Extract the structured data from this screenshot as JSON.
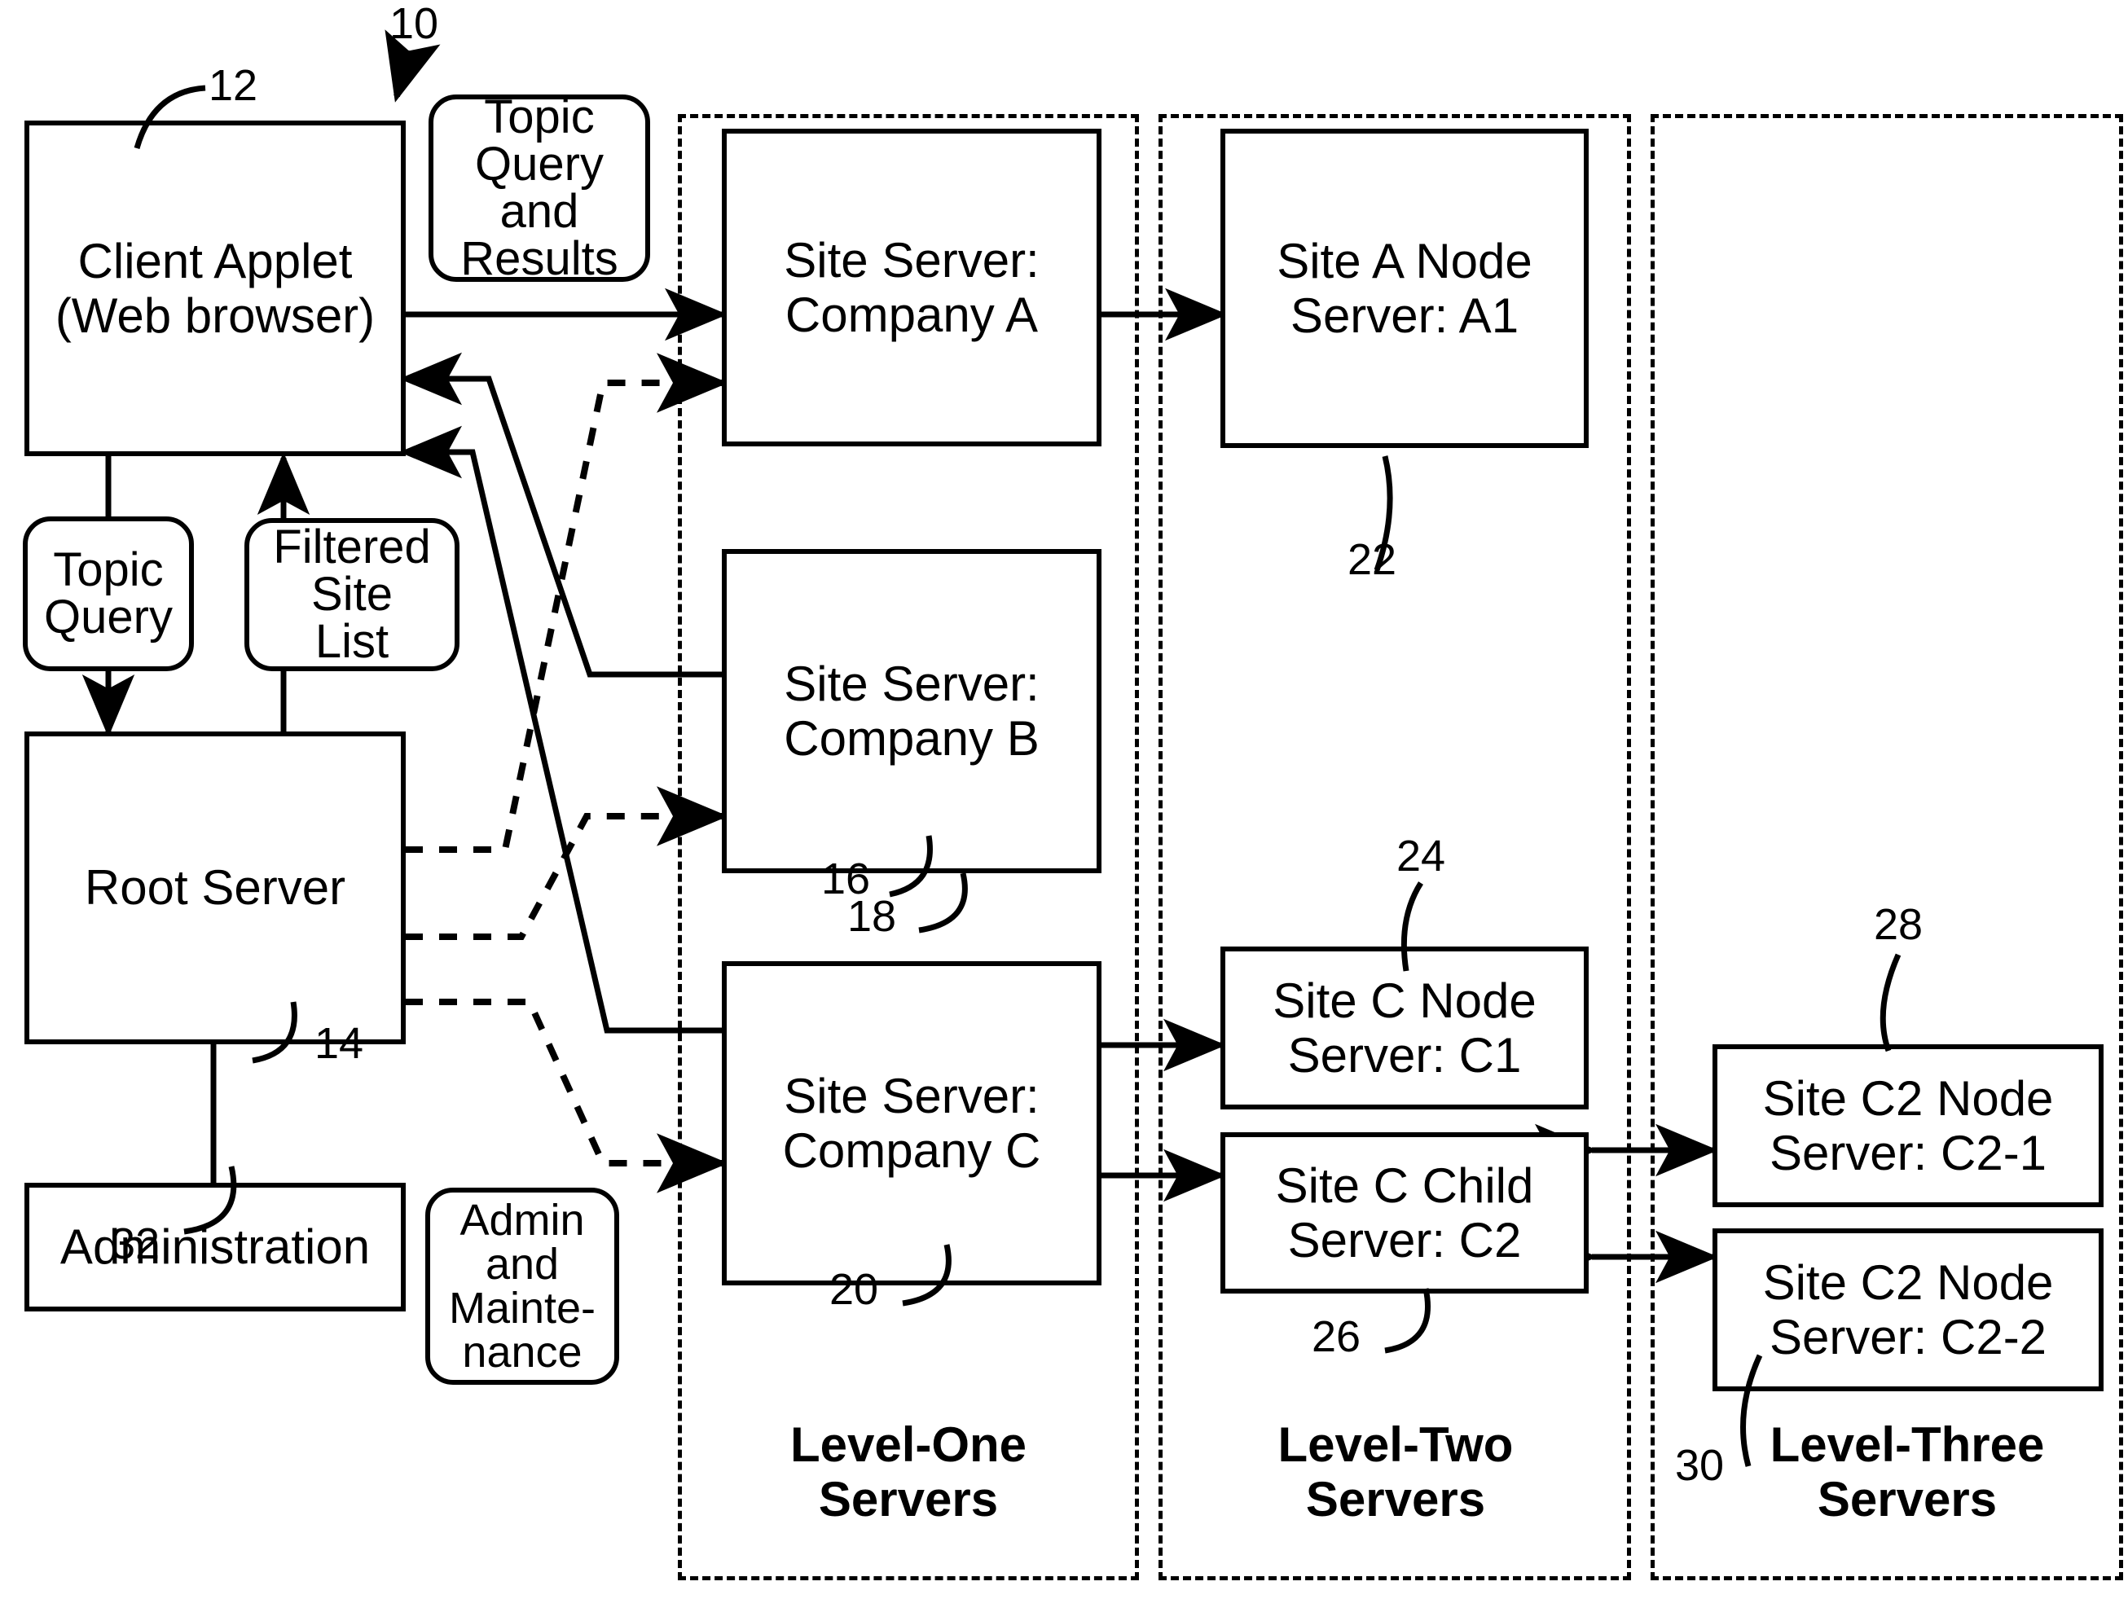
{
  "figure": {
    "type": "patent-block-diagram",
    "overall_reference": "10"
  },
  "client_side": {
    "client_applet": {
      "label": "Client Applet\n(Web browser)",
      "line1": "Client Applet",
      "line2": "(Web browser)",
      "ref": "12"
    },
    "root_server": {
      "label": "Root Server",
      "ref": "14"
    },
    "administration": {
      "label": "Administration",
      "ref": "32"
    },
    "bubbles": [
      {
        "name": "topic-query-and-results",
        "line1": "Topic",
        "line2": "Query",
        "line3": "and",
        "line4": "Results"
      },
      {
        "name": "topic-query",
        "line1": "Topic",
        "line2": "Query"
      },
      {
        "name": "filtered-site-list",
        "line1": "Filtered",
        "line2": "Site",
        "line3": "List"
      },
      {
        "name": "admin-and-maintenance",
        "line1": "Admin",
        "line2": "and",
        "line3": "Mainte-",
        "line4": "nance"
      }
    ]
  },
  "groups": [
    {
      "name": "level-one",
      "line1": "Level-One",
      "line2": "Servers"
    },
    {
      "name": "level-two",
      "line1": "Level-Two",
      "line2": "Servers"
    },
    {
      "name": "level-three",
      "line1": "Level-Three",
      "line2": "Servers",
      "ref": "30"
    }
  ],
  "level_one_servers": [
    {
      "name": "site-server-company-a",
      "line1": "Site Server:",
      "line2": "Company A",
      "ref": "16"
    },
    {
      "name": "site-server-company-b",
      "line1": "Site Server:",
      "line2": "Company B",
      "ref": "18"
    },
    {
      "name": "site-server-company-c",
      "line1": "Site Server:",
      "line2": "Company C",
      "ref": "20"
    }
  ],
  "level_two_servers": [
    {
      "name": "site-a-node-server-a1",
      "line1": "Site A Node",
      "line2": "Server: A1",
      "ref": "22"
    },
    {
      "name": "site-c-node-server-c1",
      "line1": "Site C Node",
      "line2": "Server: C1",
      "ref": "24"
    },
    {
      "name": "site-c-child-server-c2",
      "line1": "Site C Child",
      "line2": "Server: C2",
      "ref": "26"
    }
  ],
  "level_three_servers": [
    {
      "name": "site-c2-node-server-c2-1",
      "line1": "Site C2 Node",
      "line2": "Server: C2-1",
      "ref": "28"
    },
    {
      "name": "site-c2-node-server-c2-2",
      "line1": "Site C2 Node",
      "line2": "Server: C2-2"
    }
  ],
  "colors": {
    "ink": "#000000",
    "paper": "#ffffff"
  }
}
